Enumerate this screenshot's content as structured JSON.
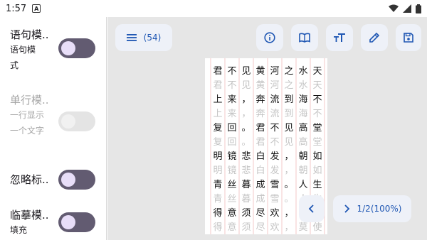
{
  "status_bar": {
    "time": "1:57",
    "notification_badge": "A"
  },
  "settings": [
    {
      "title": "语句模..",
      "subtitle": "语句模式",
      "enabled": true,
      "on": true
    },
    {
      "title": "单行模..",
      "subtitle": "一行显示一个文字",
      "enabled": false,
      "on": false
    },
    {
      "title": "忽略标..",
      "subtitle": "",
      "enabled": true,
      "on": true
    },
    {
      "title": "临摹模..",
      "subtitle": "填充",
      "enabled": true,
      "on": true
    }
  ],
  "toolbar": {
    "menu_count": "(54)",
    "icons": [
      "menu-icon",
      "info-icon",
      "book-icon",
      "text-size-icon",
      "edit-icon",
      "save-icon"
    ]
  },
  "pagination": {
    "page_label": "1/2(100%)"
  },
  "text_grid": {
    "rows": [
      [
        "君",
        "不",
        "见",
        "黄",
        "河",
        "之",
        "水",
        "天"
      ],
      [
        "君",
        "不",
        "见",
        "黄",
        "河",
        "之",
        "水",
        "天"
      ],
      [
        "上",
        "来",
        "，",
        "奔",
        "流",
        "到",
        "海",
        "不"
      ],
      [
        "上",
        "来",
        "，",
        "奔",
        "流",
        "到",
        "海",
        "不"
      ],
      [
        "复",
        "回",
        "。",
        "君",
        "不",
        "见",
        "高",
        "堂"
      ],
      [
        "复",
        "回",
        "。",
        "君",
        "不",
        "见",
        "高",
        "堂"
      ],
      [
        "明",
        "镜",
        "悲",
        "白",
        "发",
        "，",
        "朝",
        "如"
      ],
      [
        "明",
        "镜",
        "悲",
        "白",
        "发",
        "，",
        "朝",
        "如"
      ],
      [
        "青",
        "丝",
        "暮",
        "成",
        "雪",
        "。",
        "人",
        "生"
      ],
      [
        "青",
        "丝",
        "暮",
        "成",
        "雪",
        "。",
        "人",
        "生"
      ],
      [
        "得",
        "意",
        "须",
        "尽",
        "欢",
        "，",
        "",
        ""
      ],
      [
        "得",
        "意",
        "须",
        "尽",
        "欢",
        "，",
        "莫",
        "使"
      ]
    ]
  },
  "colors": {
    "accent": "#1e56b3",
    "toggle_on": "#625b71",
    "guide_line": "#f3c9c9"
  }
}
